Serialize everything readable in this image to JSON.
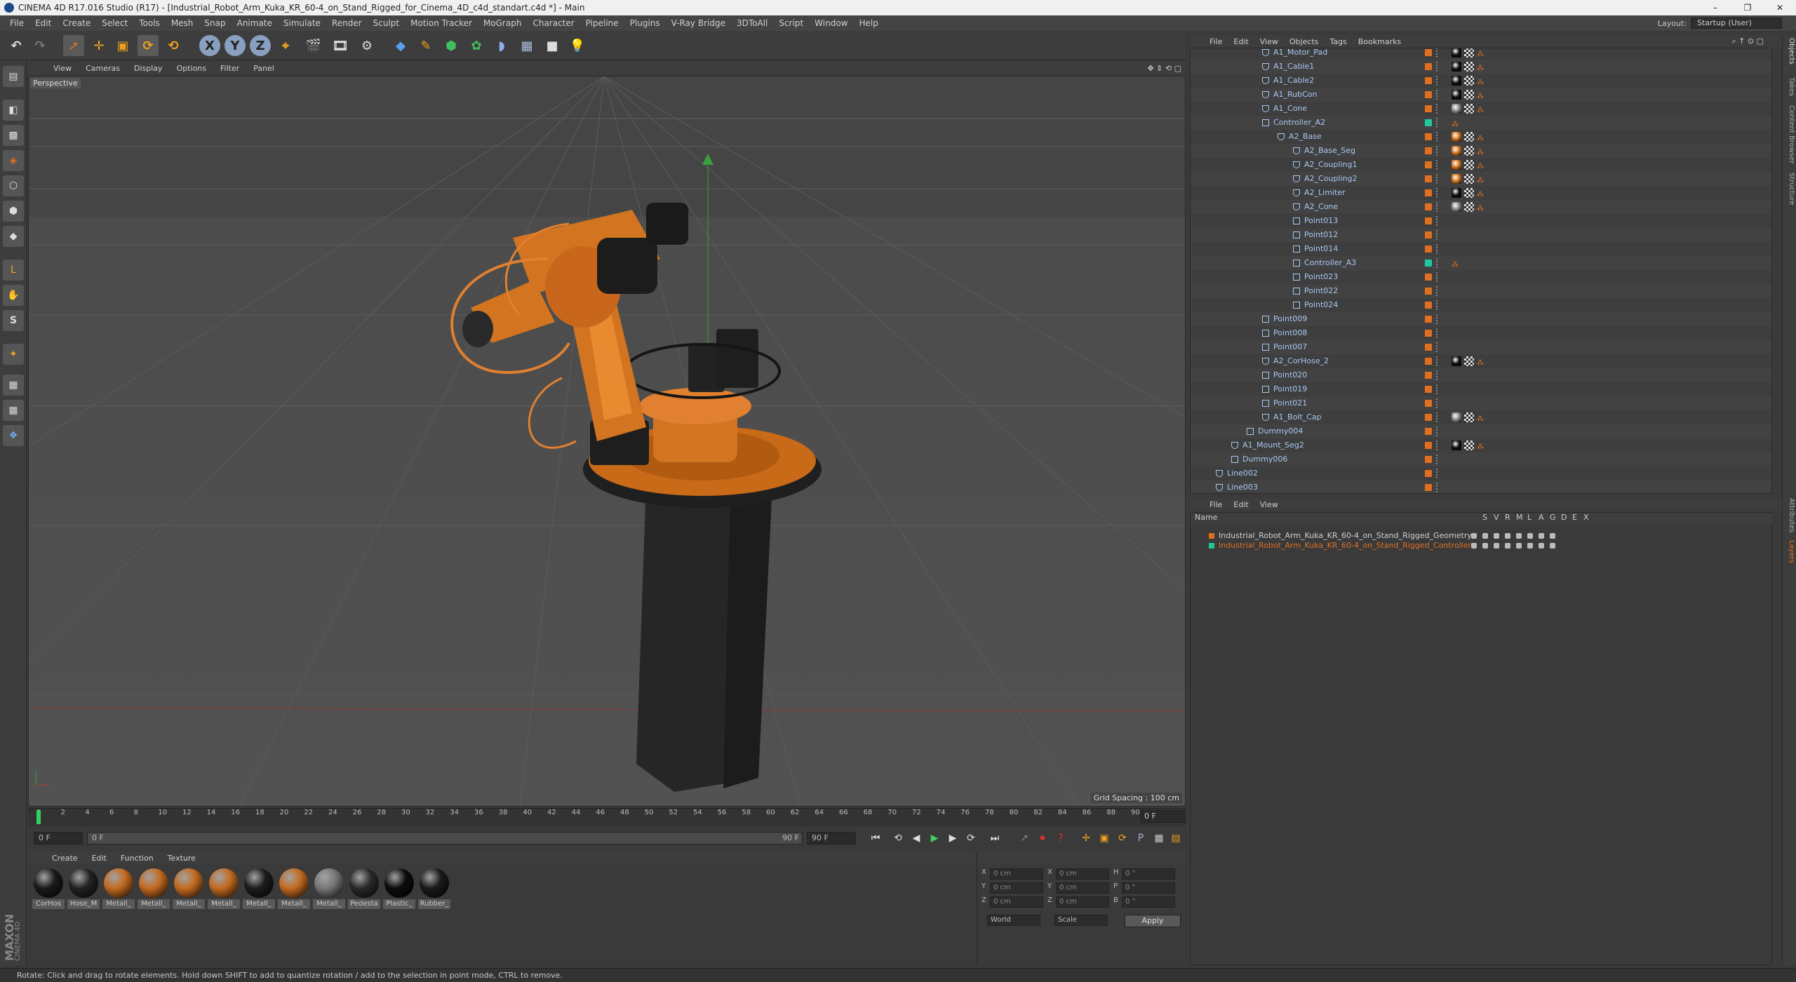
{
  "window": {
    "title": "CINEMA 4D R17.016 Studio (R17) - [Industrial_Robot_Arm_Kuka_KR_60-4_on_Stand_Rigged_for_Cinema_4D_c4d_standart.c4d *] - Main",
    "controls": [
      "–",
      "❐",
      "✕"
    ]
  },
  "menubar": {
    "items": [
      "File",
      "Edit",
      "Create",
      "Select",
      "Tools",
      "Mesh",
      "Snap",
      "Animate",
      "Simulate",
      "Render",
      "Sculpt",
      "Motion Tracker",
      "MoGraph",
      "Character",
      "Pipeline",
      "Plugins",
      "V-Ray Bridge",
      "3DToAll",
      "Script",
      "Window",
      "Help"
    ],
    "layout_label": "Layout:",
    "layout_value": "Startup (User)"
  },
  "toolbar": {
    "axis_x": "X",
    "axis_y": "Y",
    "axis_z": "Z"
  },
  "viewport": {
    "menu": [
      "View",
      "Cameras",
      "Display",
      "Options",
      "Filter",
      "Panel"
    ],
    "label": "Perspective",
    "grid_spacing": "Grid Spacing : 100 cm"
  },
  "timeline": {
    "ticks": [
      "0",
      "2",
      "4",
      "6",
      "8",
      "10",
      "12",
      "14",
      "16",
      "18",
      "20",
      "22",
      "24",
      "26",
      "28",
      "30",
      "32",
      "34",
      "36",
      "38",
      "40",
      "42",
      "44",
      "46",
      "48",
      "50",
      "52",
      "54",
      "56",
      "58",
      "60",
      "62",
      "64",
      "66",
      "68",
      "70",
      "72",
      "74",
      "76",
      "78",
      "80",
      "82",
      "84",
      "86",
      "88",
      "90"
    ],
    "current_frame": "0 F",
    "start_field": "0 F",
    "start_inner": "0 F",
    "end_inner": "90 F",
    "end_field": "90 F"
  },
  "materials": {
    "menu": [
      "Create",
      "Edit",
      "Function",
      "Texture"
    ],
    "items": [
      {
        "name": "CorHos",
        "color": "#1a1a1a"
      },
      {
        "name": "Hose_M",
        "color": "#222222"
      },
      {
        "name": "Metall_",
        "color": "#c46a20"
      },
      {
        "name": "Metall_",
        "color": "#c46a20"
      },
      {
        "name": "Metall_",
        "color": "#c46a20"
      },
      {
        "name": "Metall_",
        "color": "#c46a20"
      },
      {
        "name": "Metall_",
        "color": "#1c1c1c"
      },
      {
        "name": "Metall_",
        "color": "#c46a20"
      },
      {
        "name": "Metall_",
        "color": "#777777"
      },
      {
        "name": "Pedesta",
        "color": "#2a2a2a"
      },
      {
        "name": "Plastic_",
        "color": "#0c0c0c"
      },
      {
        "name": "Rubber_",
        "color": "#1a1a1a"
      }
    ]
  },
  "coords": {
    "rows": [
      {
        "a": "X",
        "av": "0 cm",
        "b": "X",
        "bv": "0 cm",
        "c": "H",
        "cv": "0 °"
      },
      {
        "a": "Y",
        "av": "0 cm",
        "b": "Y",
        "bv": "0 cm",
        "c": "P",
        "cv": "0 °"
      },
      {
        "a": "Z",
        "av": "0 cm",
        "b": "Z",
        "bv": "0 cm",
        "c": "B",
        "cv": "0 °"
      }
    ],
    "mode1": "World",
    "mode2": "Scale",
    "apply": "Apply"
  },
  "status": {
    "text": "Rotate: Click and drag to rotate elements. Hold down SHIFT to add to quantize rotation / add to the selection in point mode, CTRL to remove."
  },
  "branding": {
    "maxon": "MAXON",
    "cinema": "CINEMA 4D"
  },
  "object_manager": {
    "menu": [
      "File",
      "Edit",
      "View",
      "Objects",
      "Tags",
      "Bookmarks"
    ],
    "rows": [
      {
        "name": "A1_Motor_Pad",
        "indent": 3,
        "kind": "bone",
        "tag": "black"
      },
      {
        "name": "A1_Cable1",
        "indent": 3,
        "kind": "bone",
        "tag": "black"
      },
      {
        "name": "A1_Cable2",
        "indent": 3,
        "kind": "bone",
        "tag": "black"
      },
      {
        "name": "A1_RubCon",
        "indent": 3,
        "kind": "bone",
        "tag": "black"
      },
      {
        "name": "A1_Cone",
        "indent": 3,
        "kind": "bone",
        "tag": "grey"
      },
      {
        "name": "Controller_A2",
        "indent": 3,
        "kind": "null",
        "tag": "green"
      },
      {
        "name": "A2_Base",
        "indent": 4,
        "kind": "bone",
        "tag": "orange"
      },
      {
        "name": "A2_Base_Seg",
        "indent": 5,
        "kind": "bone",
        "tag": "orange"
      },
      {
        "name": "A2_Coupling1",
        "indent": 5,
        "kind": "bone",
        "tag": "orange"
      },
      {
        "name": "A2_Coupling2",
        "indent": 5,
        "kind": "bone",
        "tag": "orange"
      },
      {
        "name": "A2_Limiter",
        "indent": 5,
        "kind": "bone",
        "tag": "black"
      },
      {
        "name": "A2_Cone",
        "indent": 5,
        "kind": "bone",
        "tag": "grey"
      },
      {
        "name": "Point013",
        "indent": 5,
        "kind": "null",
        "tag": "none"
      },
      {
        "name": "Point012",
        "indent": 5,
        "kind": "null",
        "tag": "none"
      },
      {
        "name": "Point014",
        "indent": 5,
        "kind": "null",
        "tag": "none"
      },
      {
        "name": "Controller_A3",
        "indent": 5,
        "kind": "null",
        "tag": "green"
      },
      {
        "name": "Point023",
        "indent": 5,
        "kind": "null",
        "tag": "none"
      },
      {
        "name": "Point022",
        "indent": 5,
        "kind": "null",
        "tag": "none"
      },
      {
        "name": "Point024",
        "indent": 5,
        "kind": "null",
        "tag": "none"
      },
      {
        "name": "Point009",
        "indent": 3,
        "kind": "null",
        "tag": "none"
      },
      {
        "name": "Point008",
        "indent": 3,
        "kind": "null",
        "tag": "none"
      },
      {
        "name": "Point007",
        "indent": 3,
        "kind": "null",
        "tag": "none"
      },
      {
        "name": "A2_CorHose_2",
        "indent": 3,
        "kind": "bone",
        "tag": "black"
      },
      {
        "name": "Point020",
        "indent": 3,
        "kind": "null",
        "tag": "none"
      },
      {
        "name": "Point019",
        "indent": 3,
        "kind": "null",
        "tag": "none"
      },
      {
        "name": "Point021",
        "indent": 3,
        "kind": "null",
        "tag": "none"
      },
      {
        "name": "A1_Bolt_Cap",
        "indent": 3,
        "kind": "bone",
        "tag": "grey"
      },
      {
        "name": "Dummy004",
        "indent": 2,
        "kind": "null",
        "tag": "none"
      },
      {
        "name": "A1_Mount_Seg2",
        "indent": 1,
        "kind": "bone",
        "tag": "black"
      },
      {
        "name": "Dummy006",
        "indent": 1,
        "kind": "null",
        "tag": "none"
      },
      {
        "name": "Line002",
        "indent": 0,
        "kind": "bone",
        "tag": "none"
      },
      {
        "name": "Line003",
        "indent": 0,
        "kind": "bone",
        "tag": "none"
      }
    ]
  },
  "layer_manager": {
    "menu": [
      "File",
      "Edit",
      "View"
    ],
    "col_name": "Name",
    "col_flags": [
      "S",
      "V",
      "R",
      "M",
      "L",
      "A",
      "G",
      "D",
      "E",
      "X"
    ],
    "layers": [
      {
        "name": "Industrial_Robot_Arm_Kuka_KR_60-4_on_Stand_Rigged_Geometry",
        "color": "#e07020"
      },
      {
        "name": "Industrial_Robot_Arm_Kuka_KR_60-4_on_Stand_Rigged_Controllers",
        "color": "#20c890"
      }
    ]
  },
  "side_tabs": [
    "Objects",
    "Takes",
    "Content Browser",
    "Structure",
    "Attributes",
    "Layers"
  ],
  "colors": {
    "accent_orange": "#e07020",
    "accent_green": "#20c890",
    "object_name": "#a8c8f0"
  }
}
